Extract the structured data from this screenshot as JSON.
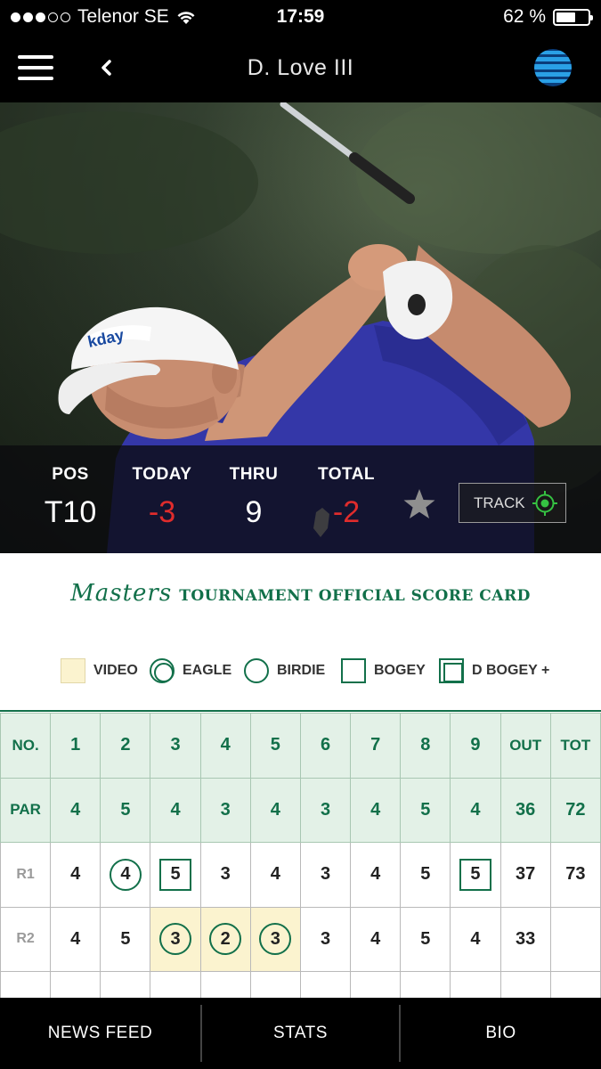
{
  "status_bar": {
    "carrier": "Telenor SE",
    "time": "17:59",
    "battery": "62 %",
    "battery_level": 0.62
  },
  "header": {
    "title": "D. Love III"
  },
  "player": {
    "stats": [
      {
        "label": "POS",
        "value": "T10"
      },
      {
        "label": "TODAY",
        "value": "-3"
      },
      {
        "label": "THRU",
        "value": "9"
      },
      {
        "label": "TOTAL",
        "value": "-2"
      }
    ],
    "track_label": "TRACK"
  },
  "scorecard": {
    "title_script": "Masters",
    "title_rest": "TOURNAMENT OFFICIAL SCORE CARD",
    "legend": [
      "VIDEO",
      "EAGLE",
      "BIRDIE",
      "BOGEY",
      "D BOGEY +"
    ],
    "holes": [
      "NO.",
      "1",
      "2",
      "3",
      "4",
      "5",
      "6",
      "7",
      "8",
      "9",
      "OUT",
      "TOT"
    ],
    "par": [
      "PAR",
      "4",
      "5",
      "4",
      "3",
      "4",
      "3",
      "4",
      "5",
      "4",
      "36",
      "72"
    ],
    "rounds": [
      {
        "label": "R1",
        "scores": [
          "4",
          "4",
          "5",
          "3",
          "4",
          "3",
          "4",
          "5",
          "5",
          "37",
          "73"
        ]
      },
      {
        "label": "R2",
        "scores": [
          "4",
          "5",
          "3",
          "2",
          "3",
          "3",
          "4",
          "5",
          "4",
          "33",
          ""
        ]
      }
    ]
  },
  "bottom_nav": [
    "NEWS FEED",
    "STATS",
    "BIO"
  ],
  "colors": {
    "masters_green": "#12704a",
    "negative_red": "#e02c2c",
    "video_highlight": "#fbf3cf"
  }
}
